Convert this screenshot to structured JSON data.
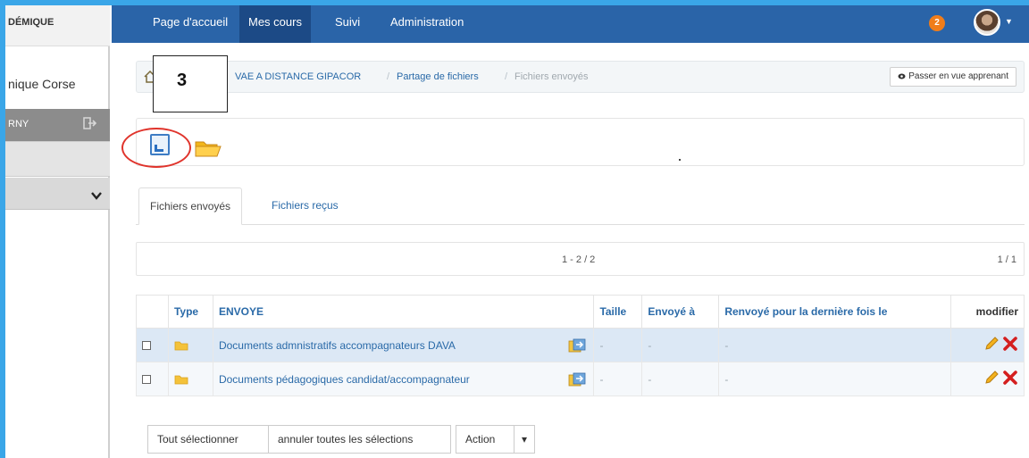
{
  "sidebar": {
    "brand": "DÉMIQUE",
    "org": "nique Corse",
    "user": "RNY"
  },
  "nav": {
    "items": [
      "Page d'accueil",
      "Mes cours",
      "Suivi",
      "Administration"
    ],
    "active_index": 1,
    "notification_count": "2"
  },
  "breadcrumb": {
    "course": "VAE A DISTANCE GIPACOR",
    "section": "Partage de fichiers",
    "current": "Fichiers envoyés",
    "student_view_button": "Passer en vue apprenant"
  },
  "callout": "3",
  "tabs": [
    "Fichiers envoyés",
    "Fichiers reçus"
  ],
  "pager": {
    "range": "1 - 2 / 2",
    "pages": "1 / 1"
  },
  "table": {
    "headers": [
      "Type",
      "ENVOYE",
      "Taille",
      "Envoyé à",
      "Renvoyé pour la dernière fois le",
      "modifier"
    ],
    "rows": [
      {
        "name": "Documents admnistratifs accompagnateurs DAVA",
        "size": "-",
        "sent_to": "-",
        "resent": "-"
      },
      {
        "name": "Documents pédagogiques candidat/accompagnateur",
        "size": "-",
        "sent_to": "-",
        "resent": "-"
      }
    ]
  },
  "actions": {
    "select_all": "Tout sélectionner",
    "unselect_all": "annuler toutes les sélections",
    "action": "Action"
  },
  "colors": {
    "nav_bg": "#2a64a8",
    "nav_active": "#1c4a86",
    "link": "#2a6aa8",
    "badge": "#f07d1a",
    "highlight_row": "#dce8f5",
    "callout_circle": "#e0342c"
  }
}
